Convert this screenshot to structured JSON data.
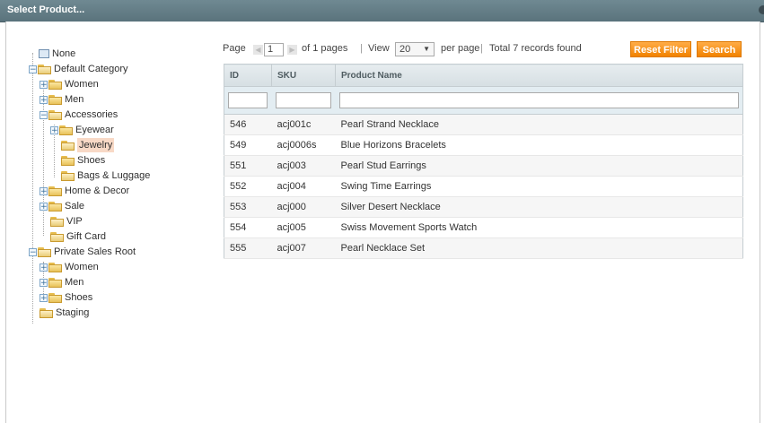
{
  "window": {
    "title": "Select Product..."
  },
  "tree": {
    "none": "None",
    "default_category": "Default Category",
    "women": "Women",
    "men": "Men",
    "accessories": "Accessories",
    "eyewear": "Eyewear",
    "jewelry": "Jewelry",
    "shoes": "Shoes",
    "bags": "Bags & Luggage",
    "home_decor": "Home & Decor",
    "sale": "Sale",
    "vip": "VIP",
    "gift_card": "Gift Card",
    "private_sales_root": "Private Sales Root",
    "ps_women": "Women",
    "ps_men": "Men",
    "ps_shoes": "Shoes",
    "staging": "Staging"
  },
  "pager": {
    "page_label": "Page",
    "page_value": "1",
    "of_pages": "of 1 pages",
    "sep1": "|",
    "view_label": "View",
    "view_value": "20",
    "per_page": "per page",
    "sep2": "|",
    "total": "Total 7 records found"
  },
  "buttons": {
    "reset_filter": "Reset Filter",
    "search": "Search"
  },
  "grid": {
    "columns": [
      "ID",
      "SKU",
      "Product Name"
    ],
    "rows": [
      [
        "546",
        "acj001c",
        "Pearl Strand Necklace"
      ],
      [
        "549",
        "acj0006s",
        "Blue Horizons Bracelets"
      ],
      [
        "551",
        "acj003",
        "Pearl Stud Earrings"
      ],
      [
        "552",
        "acj004",
        "Swing Time Earrings"
      ],
      [
        "553",
        "acj000",
        "Silver Desert Necklace"
      ],
      [
        "554",
        "acj005",
        "Swiss Movement Sports Watch"
      ],
      [
        "555",
        "acj007",
        "Pearl Necklace Set"
      ]
    ]
  },
  "colors": {
    "titlebar": "#62808a",
    "button": "#f18200",
    "selected": "#f8d9c6"
  }
}
